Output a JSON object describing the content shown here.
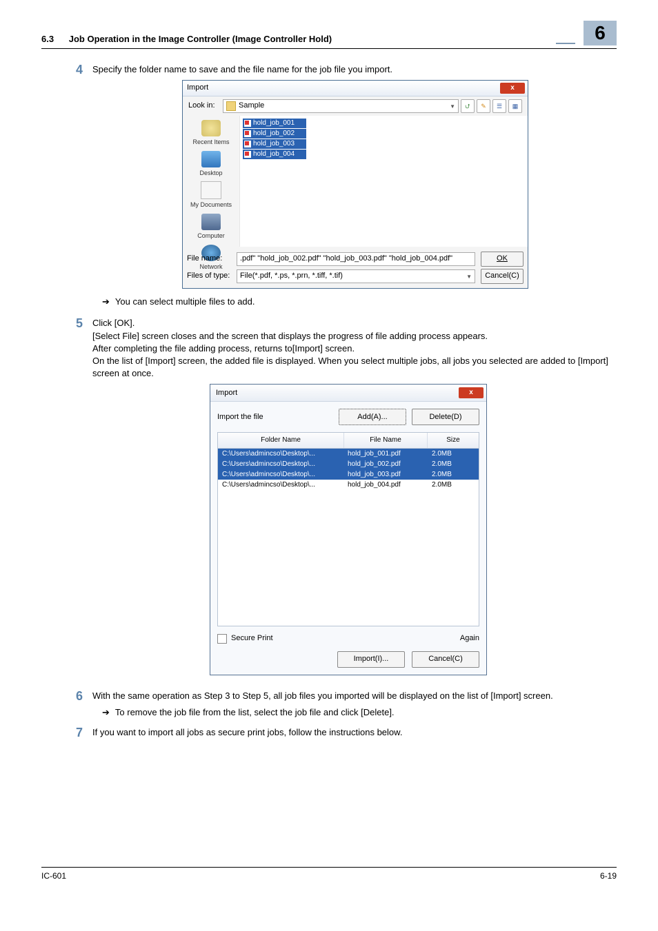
{
  "header": {
    "section_num": "6.3",
    "section_title": "Job Operation in the Image Controller (Image Controller Hold)",
    "chapter_num": "6"
  },
  "step4": {
    "num": "4",
    "text": "Specify the folder name to save and the file name for the job file you import.",
    "sub1": "You can select multiple files to add."
  },
  "dlg1": {
    "title": "Import",
    "lookin_label": "Look in:",
    "lookin_value": "Sample",
    "places": {
      "recent": "Recent Items",
      "desktop": "Desktop",
      "documents": "My Documents",
      "computer": "Computer",
      "network": "Network"
    },
    "files": [
      "hold_job_001",
      "hold_job_002",
      "hold_job_003",
      "hold_job_004"
    ],
    "filename_label": "File name:",
    "filename_value": ".pdf\" \"hold_job_002.pdf\" \"hold_job_003.pdf\" \"hold_job_004.pdf\"",
    "filetype_label": "Files of type:",
    "filetype_value": "File(*.pdf, *.ps, *.prn, *.tiff, *.tif)",
    "ok": "OK",
    "cancel": "Cancel(C)"
  },
  "step5": {
    "num": "5",
    "line1": "Click [OK].",
    "line2": "[Select File] screen closes and the screen that displays the progress of file adding process appears.",
    "line3": "After completing the file adding process, returns to[Import] screen.",
    "line4": "On the list of [Import] screen, the added file is displayed. When you select multiple jobs, all jobs you selected are added to [Import] screen at once."
  },
  "dlg2": {
    "title": "Import",
    "import_file": "Import the file",
    "add": "Add(A)...",
    "delete": "Delete(D)",
    "th_folder": "Folder Name",
    "th_file": "File Name",
    "th_size": "Size",
    "rows": [
      {
        "folder": "C:\\Users\\admincso\\Desktop\\...",
        "file": "hold_job_001.pdf",
        "size": "2.0MB",
        "sel": true
      },
      {
        "folder": "C:\\Users\\admincso\\Desktop\\...",
        "file": "hold_job_002.pdf",
        "size": "2.0MB",
        "sel": true
      },
      {
        "folder": "C:\\Users\\admincso\\Desktop\\...",
        "file": "hold_job_003.pdf",
        "size": "2.0MB",
        "sel": true
      },
      {
        "folder": "C:\\Users\\admincso\\Desktop\\...",
        "file": "hold_job_004.pdf",
        "size": "2.0MB",
        "sel": false
      }
    ],
    "secure": "Secure Print",
    "again": "Again",
    "import": "Import(I)...",
    "cancel": "Cancel(C)"
  },
  "step6": {
    "num": "6",
    "text": "With the same operation as Step 3 to Step 5, all job files you imported will be displayed on the list of [Import] screen.",
    "sub1": "To remove the job file from the list, select the job file and click [Delete]."
  },
  "step7": {
    "num": "7",
    "text": "If you want to import all jobs as secure print jobs, follow the instructions below."
  },
  "footer": {
    "left": "IC-601",
    "right": "6-19"
  }
}
